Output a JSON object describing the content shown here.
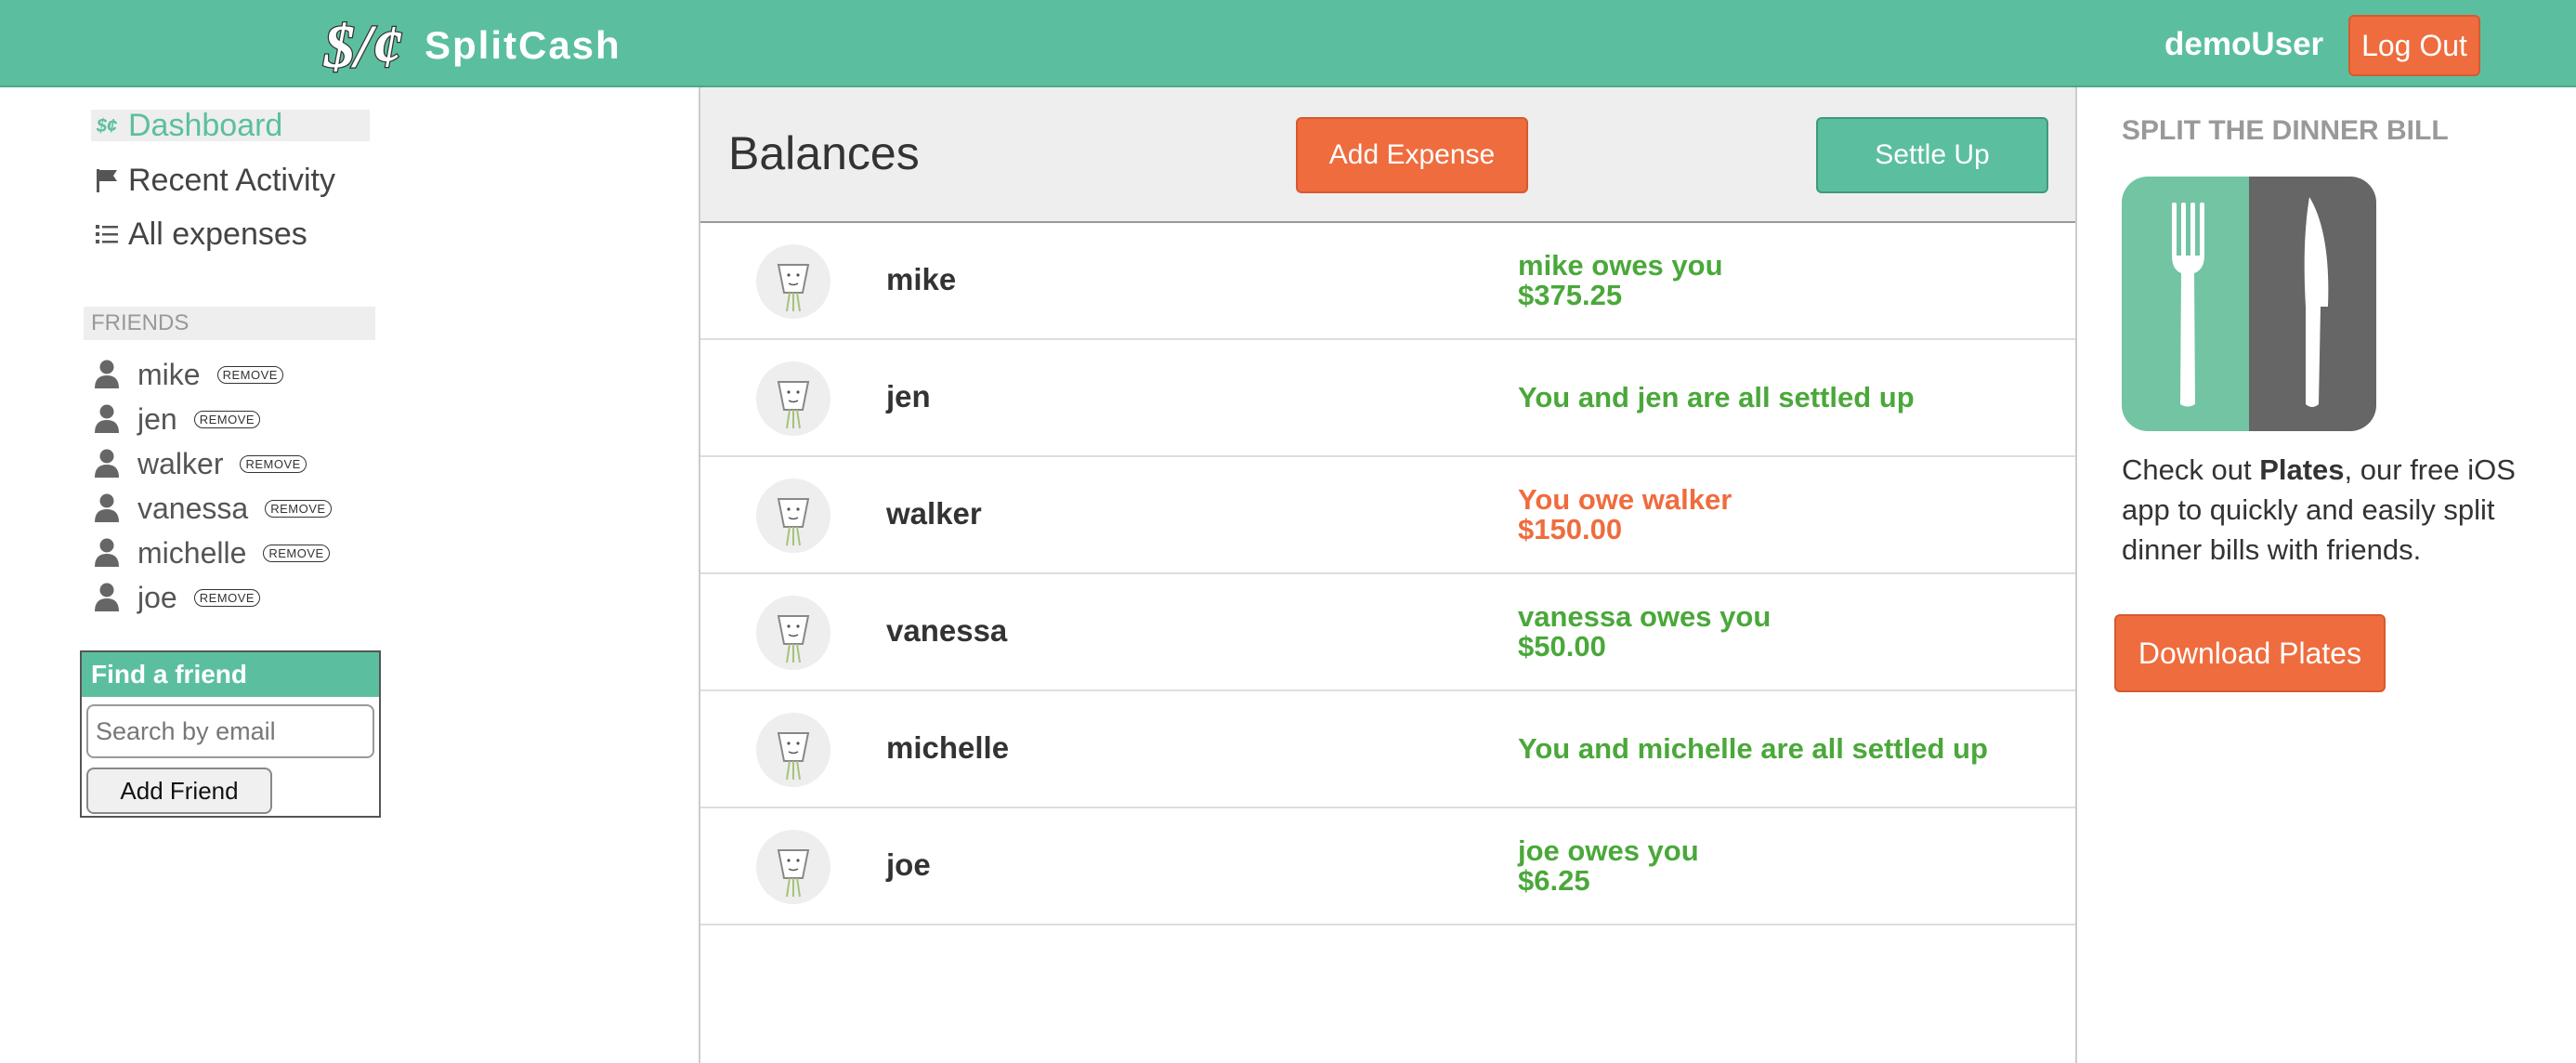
{
  "header": {
    "brand": "SplitCash",
    "logo_text": "$/¢",
    "user": "demoUser",
    "logout_label": "Log Out"
  },
  "sidebar": {
    "nav": [
      {
        "label": "Dashboard",
        "icon": "money-icon",
        "active": true
      },
      {
        "label": "Recent Activity",
        "icon": "flag-icon",
        "active": false
      },
      {
        "label": "All expenses",
        "icon": "list-icon",
        "active": false
      }
    ],
    "friends_heading": "FRIENDS",
    "remove_label": "REMOVE",
    "friends": [
      "mike",
      "jen",
      "walker",
      "vanessa",
      "michelle",
      "joe"
    ],
    "find_friend": {
      "title": "Find a friend",
      "placeholder": "Search by email",
      "button_label": "Add Friend"
    }
  },
  "main": {
    "title": "Balances",
    "add_expense_label": "Add Expense",
    "settle_up_label": "Settle Up",
    "balances": [
      {
        "name": "mike",
        "status_line1": "mike owes you",
        "status_line2": "$375.25",
        "kind": "owed"
      },
      {
        "name": "jen",
        "status_line1": "You and jen are all settled up",
        "status_line2": "",
        "kind": "settled"
      },
      {
        "name": "walker",
        "status_line1": "You owe walker",
        "status_line2": "$150.00",
        "kind": "owe"
      },
      {
        "name": "vanessa",
        "status_line1": "vanessa owes you",
        "status_line2": "$50.00",
        "kind": "owed"
      },
      {
        "name": "michelle",
        "status_line1": "You and michelle are all settled up",
        "status_line2": "",
        "kind": "settled"
      },
      {
        "name": "joe",
        "status_line1": "joe owes you",
        "status_line2": "$6.25",
        "kind": "owed"
      }
    ]
  },
  "promo": {
    "title": "SPLIT THE DINNER BILL",
    "text_before": "Check out ",
    "text_bold": "Plates",
    "text_after": ", our free iOS app to quickly and easily split dinner bills with friends.",
    "download_label": "Download Plates"
  },
  "colors": {
    "brand_green": "#5bbf9f",
    "accent_orange": "#ef6c3e",
    "owed_green": "#4aa83a"
  }
}
